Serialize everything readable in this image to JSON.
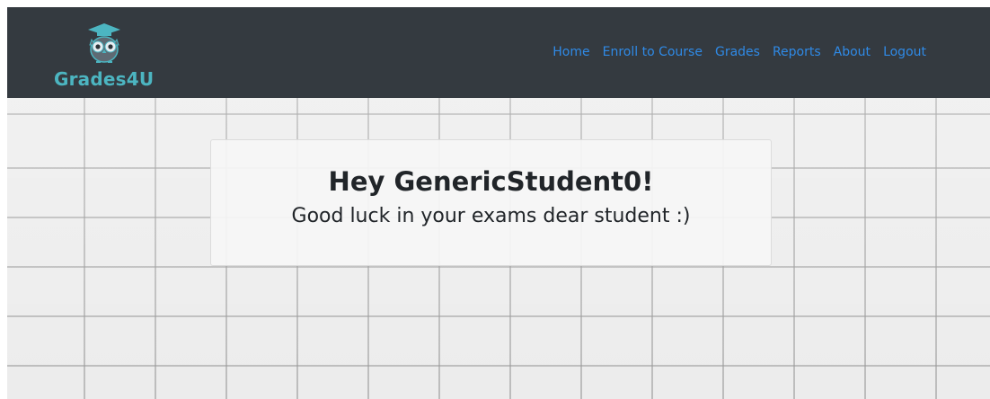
{
  "brand": {
    "name": "Grades4U",
    "logo_icon": "owl-graduation-cap-icon",
    "color": "#4cb5c1"
  },
  "nav": {
    "items": [
      {
        "label": "Home"
      },
      {
        "label": "Enroll to Course"
      },
      {
        "label": "Grades"
      },
      {
        "label": "Reports"
      },
      {
        "label": "About"
      },
      {
        "label": "Logout"
      }
    ],
    "link_color": "#2f8ae6",
    "bar_color": "#343a40"
  },
  "greeting": {
    "title": "Hey GenericStudent0!",
    "subtitle": "Good luck in your exams dear student :)"
  }
}
